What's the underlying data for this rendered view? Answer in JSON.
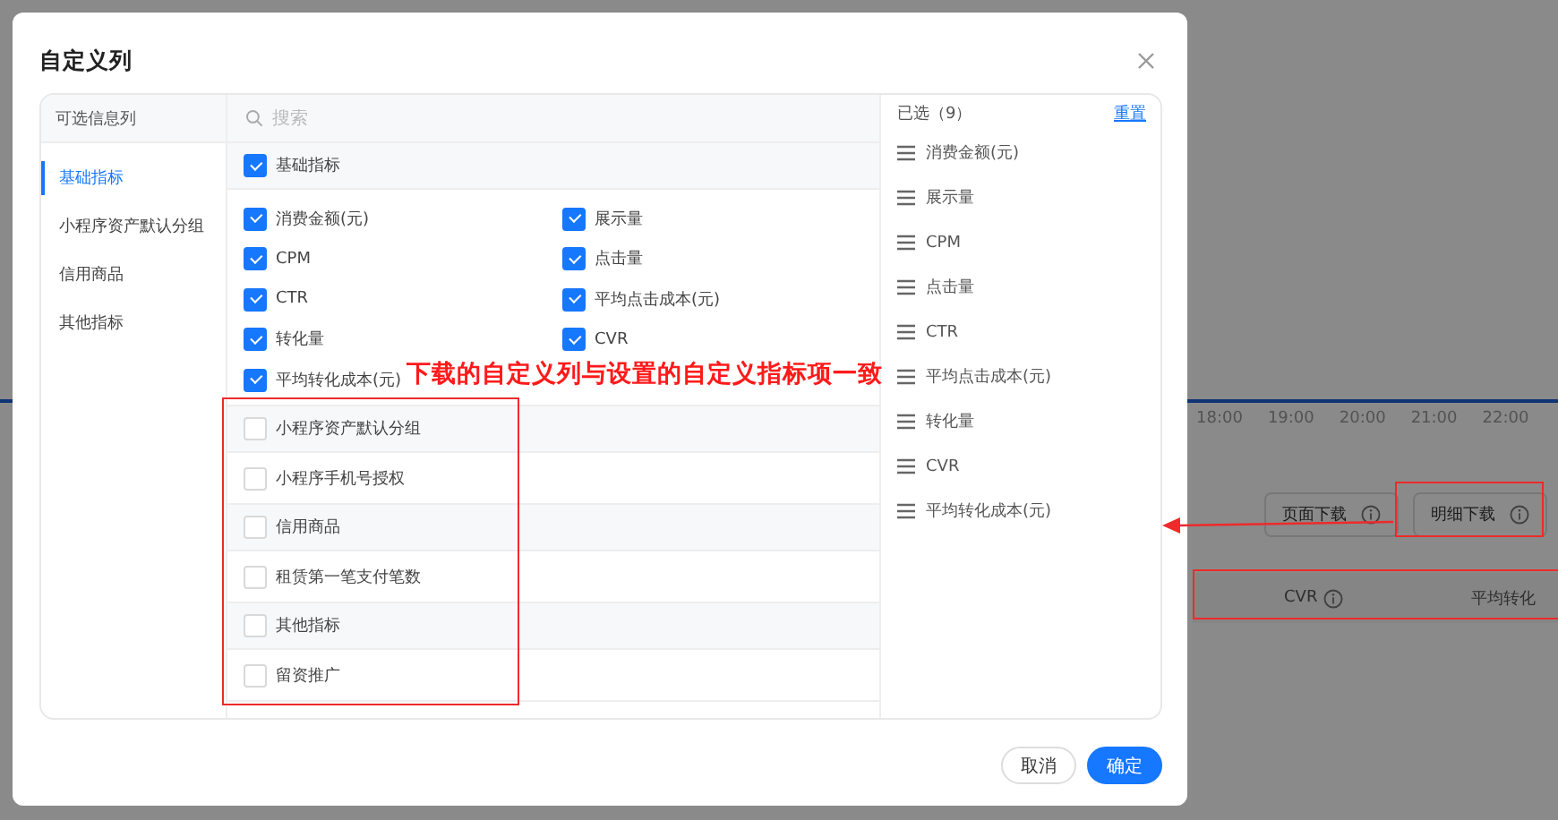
{
  "background": {
    "axis_labels": [
      "18:00",
      "19:00",
      "20:00",
      "21:00",
      "22:00"
    ],
    "buttons": [
      {
        "label": "页面下载"
      },
      {
        "label": "明细下载"
      }
    ],
    "table_headers": [
      {
        "label": "CVR",
        "info": true
      },
      {
        "label": "平均转化",
        "info": false
      }
    ]
  },
  "dialog": {
    "title": "自定义列",
    "available_header": "可选信息列",
    "search": {
      "placeholder": "搜索"
    },
    "categories": [
      {
        "label": "基础指标",
        "selected": true
      },
      {
        "label": "小程序资产默认分组",
        "selected": false
      },
      {
        "label": "信用商品",
        "selected": false
      },
      {
        "label": "其他指标",
        "selected": false
      }
    ],
    "groups": [
      {
        "label": "基础指标",
        "checked": true,
        "items": [
          {
            "label": "消费金额(元)",
            "checked": true
          },
          {
            "label": "展示量",
            "checked": true
          },
          {
            "label": "CPM",
            "checked": true
          },
          {
            "label": "点击量",
            "checked": true
          },
          {
            "label": "CTR",
            "checked": true
          },
          {
            "label": "平均点击成本(元)",
            "checked": true
          },
          {
            "label": "转化量",
            "checked": true
          },
          {
            "label": "CVR",
            "checked": true
          },
          {
            "label": "平均转化成本(元)",
            "checked": true
          }
        ]
      },
      {
        "label": "小程序资产默认分组",
        "checked": false,
        "items": [
          {
            "label": "小程序手机号授权",
            "checked": false
          }
        ]
      },
      {
        "label": "信用商品",
        "checked": false,
        "items": [
          {
            "label": "租赁第一笔支付笔数",
            "checked": false
          }
        ]
      },
      {
        "label": "其他指标",
        "checked": false,
        "items": [
          {
            "label": "留资推广",
            "checked": false
          }
        ]
      }
    ],
    "selected_header": "已选（9）",
    "reset": "重置",
    "selected_items": [
      "消费金额(元)",
      "展示量",
      "CPM",
      "点击量",
      "CTR",
      "平均点击成本(元)",
      "转化量",
      "CVR",
      "平均转化成本(元)"
    ],
    "buttons": [
      {
        "label": "取消",
        "kind": "secondary"
      },
      {
        "label": "确定",
        "kind": "primary"
      }
    ]
  },
  "annotation": {
    "text": "下载的自定义列与设置的自定义指标项一致"
  }
}
